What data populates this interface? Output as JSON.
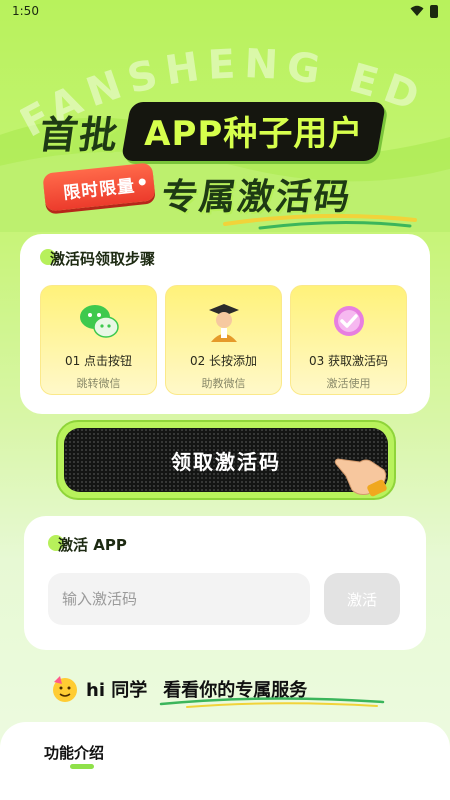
{
  "status_bar": {
    "time": "1:50"
  },
  "hero": {
    "watermark": "FANSHENG EDU",
    "headline_first": "首批",
    "headline_app": "APP种子用户",
    "limited_tag": "限时限量",
    "headline_second": "专属激活码"
  },
  "steps": {
    "title": "激活码领取步骤",
    "items": [
      {
        "title": "01 点击按钮",
        "subtitle": "跳转微信",
        "icon": "wechat-icon"
      },
      {
        "title": "02 长按添加",
        "subtitle": "助教微信",
        "icon": "teacher-icon"
      },
      {
        "title": "03 获取激活码",
        "subtitle": "激活使用",
        "icon": "check-badge-icon"
      }
    ]
  },
  "cta": {
    "label": "领取激活码"
  },
  "activate": {
    "title": "激活 APP",
    "placeholder": "输入激活码",
    "button": "激活"
  },
  "greeting": {
    "hi": "hi 同学",
    "service": "看看你的专属服务"
  },
  "features": {
    "title": "功能介绍"
  },
  "colors": {
    "accent_green": "#b8f25c",
    "dark": "#141514",
    "tag_red": "#ec3b2c",
    "step_yellow": "#fff27a"
  }
}
